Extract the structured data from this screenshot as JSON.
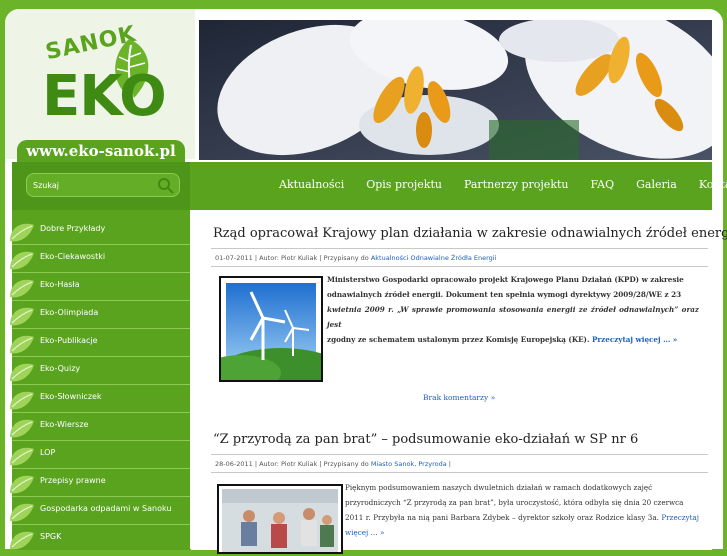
{
  "site": {
    "logo_top": "SANOK",
    "logo_main": "EKO",
    "url": "www.eko-sanok.pl"
  },
  "search": {
    "placeholder": "Szukaj"
  },
  "nav": {
    "items": [
      {
        "label": "Aktualności"
      },
      {
        "label": "Opis projektu"
      },
      {
        "label": "Partnerzy projektu"
      },
      {
        "label": "FAQ"
      },
      {
        "label": "Galeria"
      },
      {
        "label": "Kontakt"
      }
    ]
  },
  "sidebar": {
    "items": [
      {
        "label": "Dobre Przykłady"
      },
      {
        "label": "Eko-Ciekawostki"
      },
      {
        "label": "Eko-Hasła"
      },
      {
        "label": "Eko-Olimpiada"
      },
      {
        "label": "Eko-Publikacje"
      },
      {
        "label": "Eko-Quizy"
      },
      {
        "label": "Eko-Słowniczek"
      },
      {
        "label": "Eko-Wiersze"
      },
      {
        "label": "LOP"
      },
      {
        "label": "Przepisy prawne"
      },
      {
        "label": "Gospodarka odpadami w Sanoku"
      },
      {
        "label": "SPGK"
      }
    ]
  },
  "posts": [
    {
      "title": "Rząd opracował Krajowy plan działania w zakresie odnawialnych źródeł energii",
      "meta_prefix": "01-07-2011 | Autor: Piotr Kuliak | Przypisany do",
      "categories": [
        "Aktualności",
        "Odnawialne Źródła Energii"
      ],
      "text_lines": [
        "Ministerstwo Gospodarki opracowało projekt Krajowego Planu Działań (KPD) w zakresie",
        "odnawialnych źródeł energii. Dokument ten spełnia wymogi dyrektywy 2009/28/WE z 23",
        "kwietnia 2009 r. „W sprawie promowania stosowania energii ze źródeł odnawialnych” oraz jest",
        "zgodny ze schematem ustalonym przez Komisję Europejską (KE)."
      ],
      "more": "Przeczytaj więcej … »",
      "comments": "Brak komentarzy »"
    },
    {
      "title": "“Z przyrodą za pan brat” – podsumowanie eko-działań w SP nr 6",
      "meta_prefix": "28-06-2011 | Autor: Piotr Kuliak | Przypisany do",
      "categories": [
        "Miasto Sanok",
        "Przyroda"
      ],
      "text_lines": [
        "Pięknym podsumowaniem naszych dwuletnich działań w ramach dodatkowych zajęć",
        "przyrodniczych “Z przyrodą za pan brat”, była uroczystość, która odbyła się dnia 20 czerwca",
        "2011 r. Przybyła na nią pani Barbara Zdybek – dyrektor szkoły oraz Rodzice klasy 3a."
      ],
      "more": "Przeczytaj więcej … »"
    }
  ],
  "colors": {
    "brand_green": "#5aa31f",
    "dark_green": "#3f8a12",
    "link_blue": "#1f5fbf"
  }
}
